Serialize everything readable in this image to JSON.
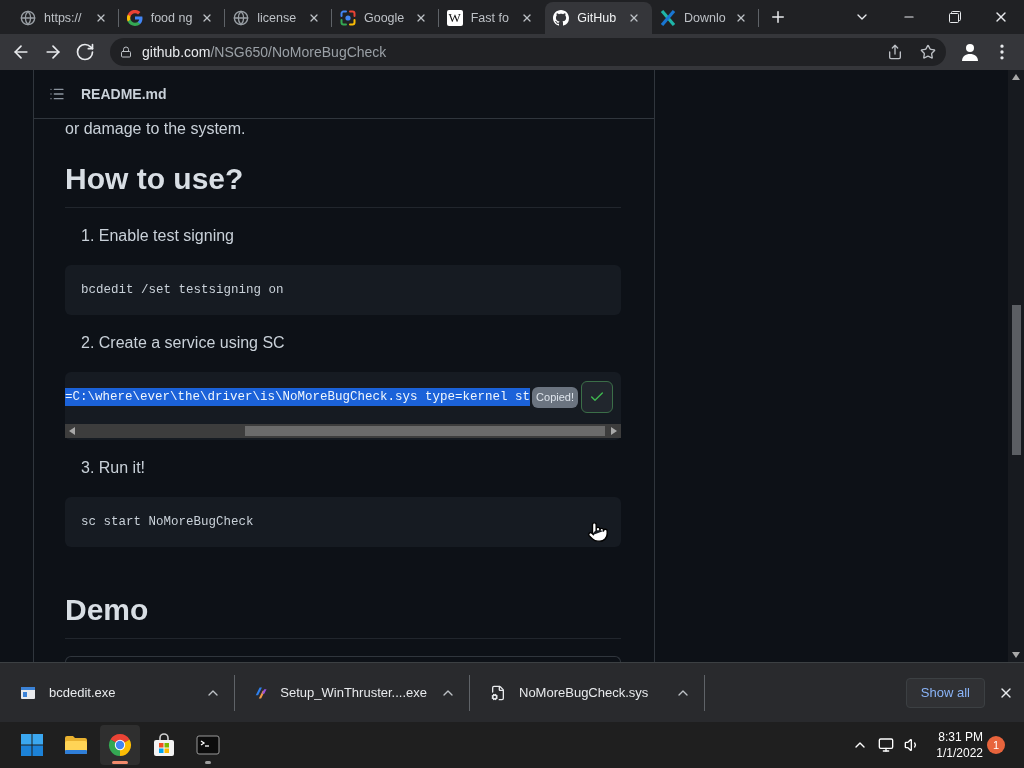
{
  "browser": {
    "tabs": [
      {
        "title": "https://",
        "selected": false
      },
      {
        "title": "food ng",
        "selected": false
      },
      {
        "title": "license",
        "selected": false
      },
      {
        "title": "Google",
        "selected": false
      },
      {
        "title": "Fast fo",
        "icon_text": "W",
        "selected": false
      },
      {
        "title": "GitHub",
        "selected": true
      },
      {
        "title": "Downlo",
        "selected": false
      }
    ],
    "address": {
      "host": "github.com",
      "path": "/NSG650/NoMoreBugCheck"
    }
  },
  "readme": {
    "filename": "README.md",
    "blocks": [
      {
        "kind": "paragraph",
        "text": "or damage to the system."
      },
      {
        "kind": "heading",
        "text": "How to use?"
      },
      {
        "kind": "step",
        "text": "1. Enable test signing"
      },
      {
        "kind": "code",
        "text": "bcdedit /set testsigning on",
        "selected": false,
        "scrollable": false
      },
      {
        "kind": "step",
        "text": "2. Create a service using SC"
      },
      {
        "kind": "code",
        "text": "=C:\\where\\ever\\the\\driver\\is\\NoMoreBugCheck.sys type=kernel st",
        "selected": true,
        "scrollable": true,
        "tooltip": "Copied!",
        "copied": true
      },
      {
        "kind": "step",
        "text": "3. Run it!"
      },
      {
        "kind": "code",
        "text": "sc start NoMoreBugCheck",
        "selected": false,
        "scrollable": false
      },
      {
        "kind": "heading",
        "text": "Demo"
      },
      {
        "kind": "frame"
      }
    ]
  },
  "downloads": {
    "items": [
      {
        "name": "bcdedit.exe"
      },
      {
        "name": "Setup_WinThruster....exe"
      },
      {
        "name": "NoMoreBugCheck.sys"
      }
    ],
    "show_all": "Show all"
  },
  "taskbar": {
    "apps": [
      {
        "selected": false,
        "running": false
      },
      {
        "selected": false,
        "running": false
      },
      {
        "selected": true,
        "running": true
      },
      {
        "selected": false,
        "running": false
      },
      {
        "selected": false,
        "running": true
      }
    ],
    "time": "8:31 PM",
    "date": "1/1/2022",
    "notifications": "1"
  }
}
